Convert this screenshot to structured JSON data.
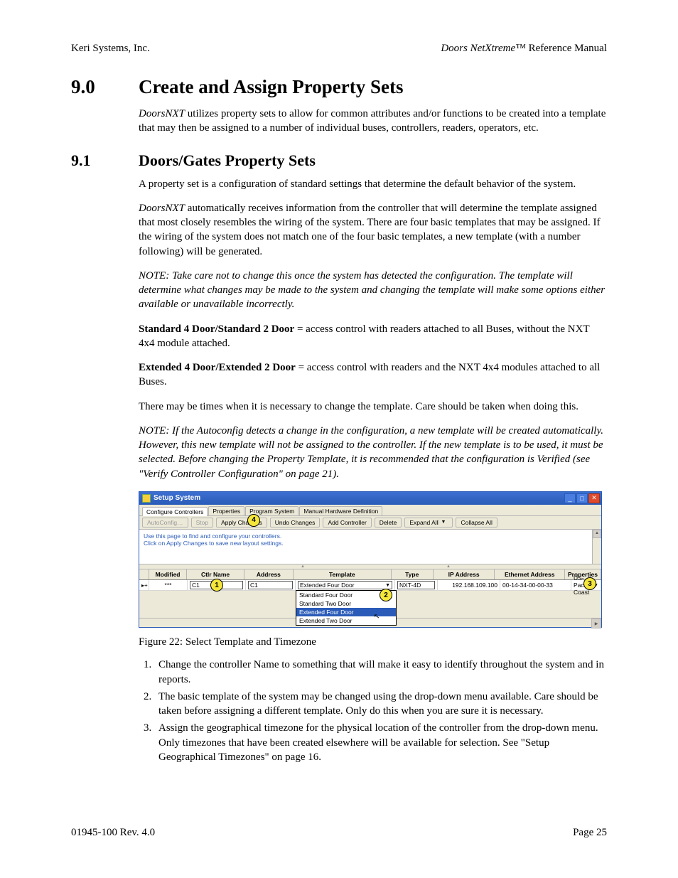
{
  "header": {
    "left": "Keri Systems, Inc.",
    "right_product": "Doors NetXtreme",
    "right_tm": "™",
    "right_suffix": " Reference Manual"
  },
  "section_main": {
    "number": "9.0",
    "title": "Create and Assign Property Sets",
    "intro_prefix_italic": "DoorsNXT",
    "intro_rest": " utilizes property sets to allow for common attributes and/or functions to be created into a template that may then be assigned to a number of individual buses, controllers, readers, operators, etc."
  },
  "section_sub": {
    "number": "9.1",
    "title": "Doors/Gates Property Sets"
  },
  "paras": {
    "p1": "A property set is a configuration of standard settings that determine the default behavior of the system.",
    "p2_prefix_italic": "DoorsNXT",
    "p2_rest": " automatically receives information from the controller that will determine the template assigned that most closely resembles the wiring of the system. There are four basic templates that may be assigned. If the wiring of the system does not match one of the four basic templates, a new template (with a number following) will be generated.",
    "note1": "NOTE: Take care not to change this once the system has detected the configuration. The template will determine what changes may be made to the system and changing the template will make some options either available or unavailable incorrectly.",
    "std_bold": "Standard 4 Door/Standard 2 Door",
    "std_rest": " = access control with readers attached to all Buses, without the NXT 4x4 module attached.",
    "ext_bold": "Extended 4 Door/Extended 2 Door",
    "ext_rest": " = access control with readers and the NXT 4x4 modules attached to all Buses.",
    "p_change": "There may be times when it is necessary to change the template. Care should be taken when doing this.",
    "note2": "NOTE: If the Autoconfig detects a change in the configuration, a new template will be created automatically. However, this new template will not be assigned to the controller. If the new template is to be used, it must be selected. Before changing the Property Template, it is recommended that the configuration is Verified (see \"Verify Controller Configuration\" on page 21)."
  },
  "figure": {
    "caption": "Figure 22: Select Template and Timezone",
    "window_title": "Setup System",
    "tabs": [
      "Configure Controllers",
      "Properties",
      "Program System",
      "Manual Hardware Definition"
    ],
    "toolbar": {
      "autoconfig": "AutoConfig…",
      "stop": "Stop",
      "apply": "Apply Changes",
      "undo": "Undo Changes",
      "add": "Add Controller",
      "delete": "Delete",
      "expand": "Expand All",
      "collapse": "Collapse All"
    },
    "hint1": "Use this page to find and configure your controllers.",
    "hint2": "Click on Apply Changes to save new layout settings.",
    "columns": {
      "modified": "Modified",
      "ctlr": "Ctlr Name",
      "addr": "Address",
      "template": "Template",
      "type": "Type",
      "ip": "IP Address",
      "eth": "Ethernet Address",
      "prop": "Properties"
    },
    "row": {
      "modified": "***",
      "ctlr": "C1",
      "addr": "C1",
      "template": "Extended Four Door",
      "type": "NXT-4D",
      "ip": "192.168.109.100",
      "eth": "00-14-34-00-00-33",
      "prop": "US-Pacific Coast"
    },
    "dropdown_options": [
      {
        "label": "Standard Four Door",
        "selected": false
      },
      {
        "label": "Standard Two Door",
        "selected": false
      },
      {
        "label": "Extended Four Door",
        "selected": true
      },
      {
        "label": "Extended Two Door",
        "selected": false
      }
    ],
    "callouts": {
      "c1": "1",
      "c2": "2",
      "c3": "3",
      "c4": "4"
    }
  },
  "steps": {
    "s1": "Change the controller Name to something that will make it easy to identify throughout the system and in reports.",
    "s2": "The basic template of the system may be changed using the drop-down menu available. Care should be taken before assigning a different template. Only do this when you are sure it is necessary.",
    "s3": "Assign the geographical timezone for the physical location of the controller from the drop-down menu. Only timezones that have been created elsewhere will be available for selection. See \"Setup Geographical Timezones\" on page 16."
  },
  "footer": {
    "left": "01945-100  Rev. 4.0",
    "right": "Page 25"
  }
}
